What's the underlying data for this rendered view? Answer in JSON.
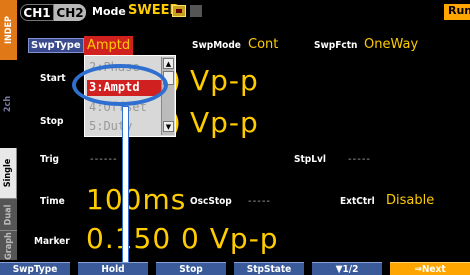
{
  "side_tabs": {
    "indep": "INDEP",
    "two_ch": "2ch",
    "single": "Single",
    "dual": "Dual",
    "graph": "Graph"
  },
  "header": {
    "ch1": "CH1",
    "ch2": "CH2",
    "mode_label": "Mode",
    "mode_value": "SWEEP",
    "run": "Run"
  },
  "fields": {
    "swptype_label": "SwpType",
    "swptype_value": "Amptd",
    "swpmode_label": "SwpMode",
    "swpmode_value": "Cont",
    "swpfctn_label": "SwpFctn",
    "swpfctn_value": "OneWay",
    "start_label": "Start",
    "start_value": "Vp-p",
    "stop_label": "Stop",
    "stop_value": "Vp-p",
    "trig_label": "Trig",
    "trig_value": "------",
    "stplvl_label": "StpLvl",
    "stplvl_value": "-----",
    "time_label": "Time",
    "time_value": "100ms",
    "oscstop_label": "OscStop",
    "oscstop_value": "-----",
    "extctrl_label": "ExtCtrl",
    "extctrl_value": "Disable",
    "marker_label": "Marker",
    "marker_value": "0.150 0 Vp-p"
  },
  "dropdown": {
    "items": [
      "2:Phase",
      "3:Amptd",
      "4:Offset",
      "5:Duty"
    ],
    "selected_index": 1
  },
  "softkeys": {
    "k1": "SwpType",
    "k2": "Hold",
    "k3": "Stop",
    "k4": "StpState",
    "k5": "▼1/2",
    "k6": "⇒Next"
  },
  "colors": {
    "accent": "#ffcc00",
    "selection": "#d02020",
    "softkey": "#3a5a9a",
    "next": "#ffa500",
    "callout": "#2f6fd0"
  }
}
